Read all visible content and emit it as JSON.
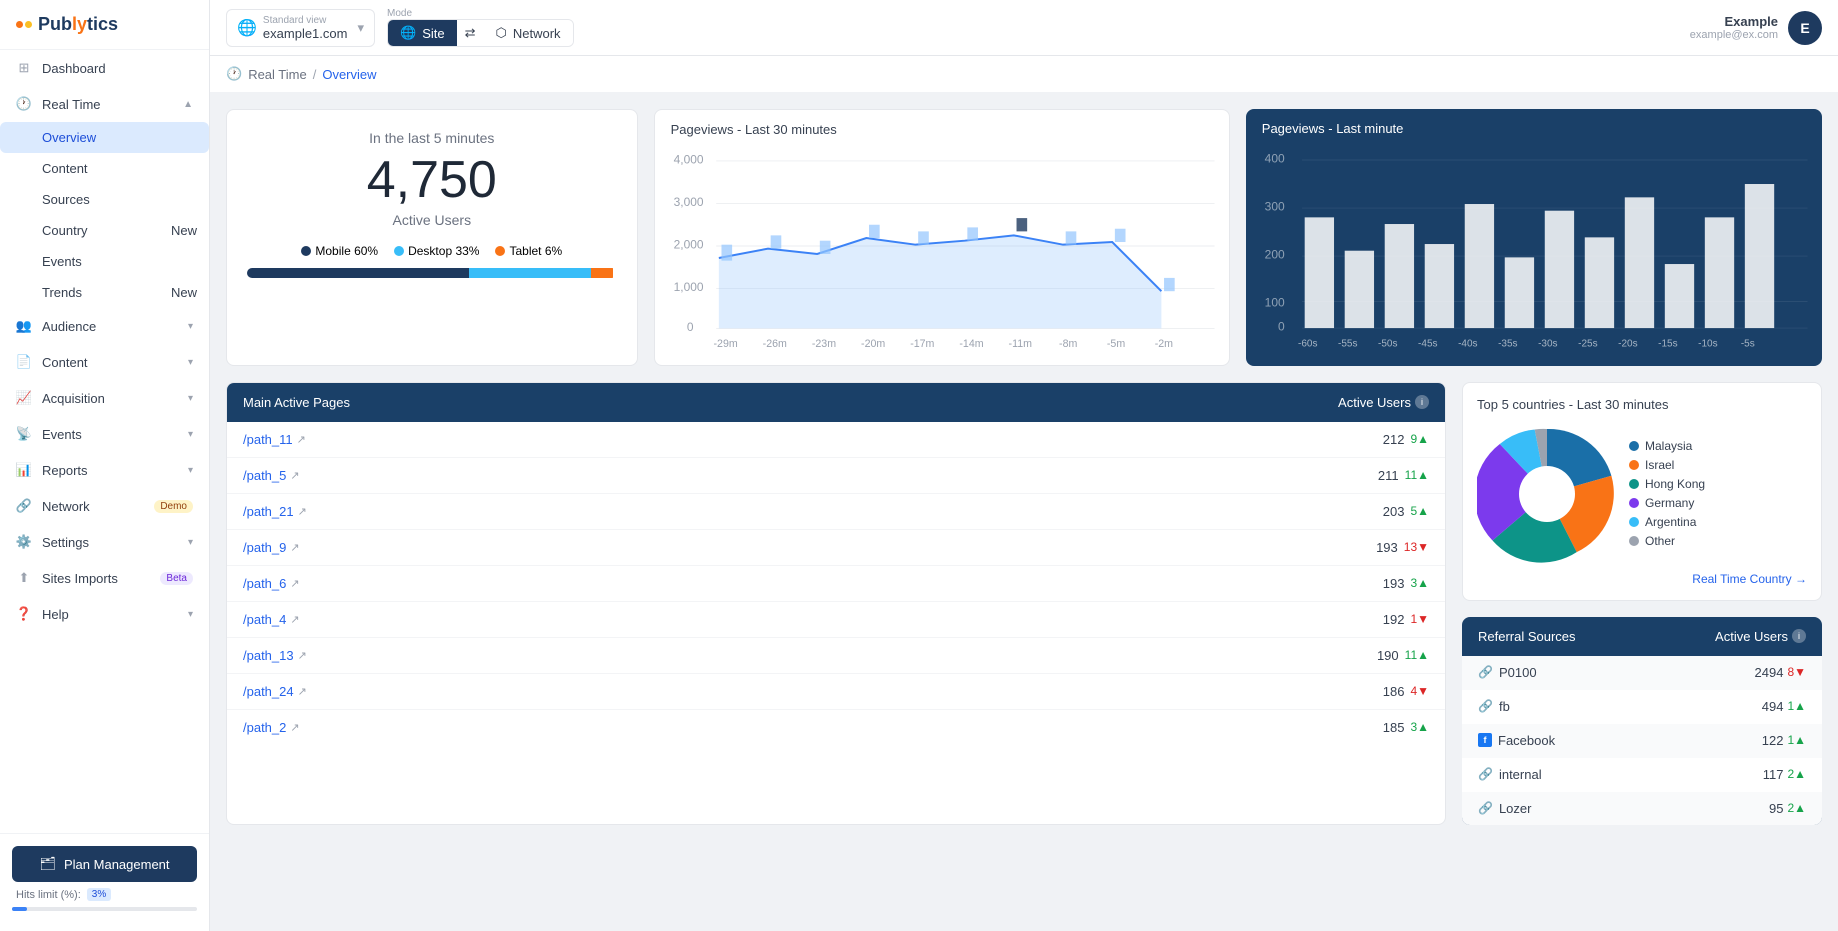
{
  "logo": {
    "text": "Publytics"
  },
  "topbar": {
    "standard_view_label": "Standard view",
    "site": "example1.com",
    "mode_label": "Mode",
    "mode_site": "Site",
    "mode_network": "Network",
    "user_name": "Example",
    "user_email": "example@ex.com",
    "user_initial": "E"
  },
  "breadcrumb": {
    "section": "Real Time",
    "page": "Overview"
  },
  "sidebar": {
    "items": [
      {
        "id": "dashboard",
        "label": "Dashboard",
        "icon": "grid"
      },
      {
        "id": "realtime",
        "label": "Real Time",
        "icon": "clock",
        "expanded": true
      },
      {
        "id": "overview",
        "label": "Overview",
        "sub": true,
        "active": true
      },
      {
        "id": "content",
        "label": "Content",
        "sub": true
      },
      {
        "id": "sources",
        "label": "Sources",
        "sub": true
      },
      {
        "id": "country",
        "label": "Country",
        "sub": true,
        "badge": "New"
      },
      {
        "id": "events",
        "label": "Events",
        "sub": true
      },
      {
        "id": "trends",
        "label": "Trends",
        "sub": true,
        "badge": "New"
      },
      {
        "id": "audience",
        "label": "Audience",
        "icon": "users",
        "chevron": true
      },
      {
        "id": "content2",
        "label": "Content",
        "icon": "file",
        "chevron": true
      },
      {
        "id": "acquisition",
        "label": "Acquisition",
        "icon": "trending",
        "chevron": true
      },
      {
        "id": "events2",
        "label": "Events",
        "icon": "radio",
        "chevron": true
      },
      {
        "id": "reports",
        "label": "Reports",
        "icon": "bar-chart",
        "chevron": true
      },
      {
        "id": "network",
        "label": "Network",
        "icon": "share",
        "badge": "Demo"
      },
      {
        "id": "settings",
        "label": "Settings",
        "icon": "gear",
        "chevron": true
      },
      {
        "id": "sitesimports",
        "label": "Sites Imports",
        "icon": "upload",
        "badge": "Beta"
      },
      {
        "id": "help",
        "label": "Help",
        "icon": "help",
        "chevron": true
      }
    ],
    "plan_btn": "Plan Management",
    "hits_label": "Hits limit (%):",
    "hits_percent": "3%",
    "hits_value": 3
  },
  "active_users": {
    "subtitle": "In the last 5 minutes",
    "number": "4,750",
    "label": "Active Users",
    "mobile_pct": "Mobile 60%",
    "desktop_pct": "Desktop 33%",
    "tablet_pct": "Tablet 6%",
    "mobile_width": 60,
    "desktop_width": 33,
    "tablet_width": 6
  },
  "pageviews_30m": {
    "title": "Pageviews - Last 30 minutes",
    "y_labels": [
      "4,000",
      "3,000",
      "2,000",
      "1,000",
      "0"
    ],
    "x_labels": [
      "-29m",
      "-26m",
      "-23m",
      "-20m",
      "-17m",
      "-14m",
      "-11m",
      "-8m",
      "-5m",
      "-2m"
    ]
  },
  "pageviews_1m": {
    "title": "Pageviews - Last minute",
    "y_labels": [
      "400",
      "300",
      "200",
      "100",
      "0"
    ],
    "x_labels": [
      "-60s",
      "-55s",
      "-50s",
      "-45s",
      "-40s",
      "-35s",
      "-30s",
      "-25s",
      "-20s",
      "-15s",
      "-10s",
      "-5s"
    ]
  },
  "main_active_pages": {
    "col_pages": "Main Active Pages",
    "col_users": "Active Users",
    "rows": [
      {
        "path": "/path_11",
        "users": 212,
        "change": 9,
        "dir": "up"
      },
      {
        "path": "/path_5",
        "users": 211,
        "change": 11,
        "dir": "up"
      },
      {
        "path": "/path_21",
        "users": 203,
        "change": 5,
        "dir": "up"
      },
      {
        "path": "/path_9",
        "users": 193,
        "change": 13,
        "dir": "down"
      },
      {
        "path": "/path_6",
        "users": 193,
        "change": 3,
        "dir": "up"
      },
      {
        "path": "/path_4",
        "users": 192,
        "change": 1,
        "dir": "down"
      },
      {
        "path": "/path_13",
        "users": 190,
        "change": 11,
        "dir": "up"
      },
      {
        "path": "/path_24",
        "users": 186,
        "change": 4,
        "dir": "down"
      },
      {
        "path": "/path_2",
        "users": 185,
        "change": 3,
        "dir": "up"
      }
    ]
  },
  "top5_countries": {
    "title": "Top 5 countries - Last 30 minutes",
    "countries": [
      {
        "name": "Malaysia",
        "color": "#1a6fa8",
        "pct": 28
      },
      {
        "name": "Israel",
        "color": "#f97316",
        "pct": 18
      },
      {
        "name": "Hong Kong",
        "color": "#0d9488",
        "pct": 20
      },
      {
        "name": "Germany",
        "color": "#7c3aed",
        "pct": 22
      },
      {
        "name": "Argentina",
        "color": "#38bdf8",
        "pct": 8
      },
      {
        "name": "Other",
        "color": "#9ca3af",
        "pct": 4
      }
    ],
    "link": "Real Time Country →"
  },
  "referral_sources": {
    "title": "Referral Sources",
    "col_users": "Active Users",
    "rows": [
      {
        "source": "P0100",
        "type": "link",
        "count": 2494,
        "change": 8,
        "dir": "down"
      },
      {
        "source": "fb",
        "type": "link",
        "count": 494,
        "change": 1,
        "dir": "up"
      },
      {
        "source": "Facebook",
        "type": "fb",
        "count": 122,
        "change": 1,
        "dir": "up"
      },
      {
        "source": "internal",
        "type": "link",
        "count": 117,
        "change": 2,
        "dir": "up"
      },
      {
        "source": "Lozer",
        "type": "link",
        "count": 95,
        "change": 2,
        "dir": "up"
      }
    ]
  }
}
